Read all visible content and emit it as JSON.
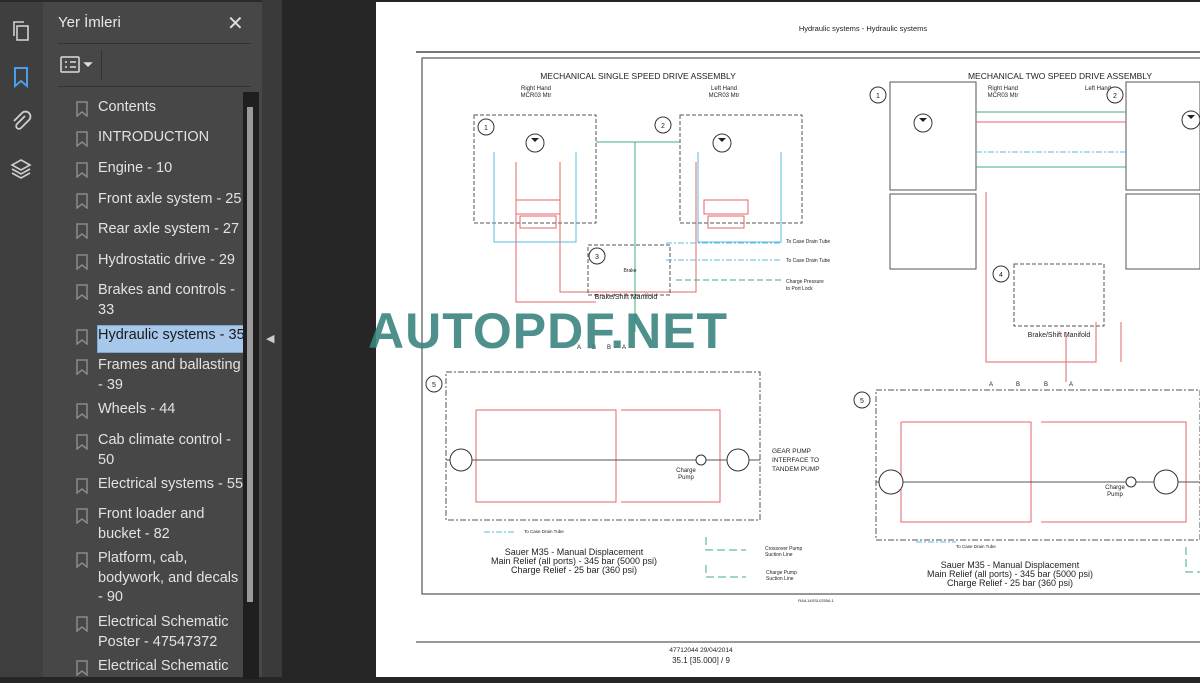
{
  "sidebar": {
    "title": "Yer İmleri",
    "close_icon": "close-icon",
    "options_icon": "list-options-icon",
    "rail_icons": [
      "pages-icon",
      "bookmark-icon",
      "attachment-icon",
      "layers-icon"
    ],
    "accent": "#4a9fe8",
    "items": [
      {
        "label": "Contents"
      },
      {
        "label": "INTRODUCTION"
      },
      {
        "label": "Engine - 10"
      },
      {
        "label": "Front axle system - 25"
      },
      {
        "label": "Rear axle system - 27"
      },
      {
        "label": "Hydrostatic drive - 29"
      },
      {
        "label": "Brakes and controls - 33"
      },
      {
        "label": "Hydraulic systems - 35",
        "selected": true
      },
      {
        "label": "Frames and ballasting - 39"
      },
      {
        "label": "Wheels - 44"
      },
      {
        "label": "Cab climate control - 50"
      },
      {
        "label": "Electrical systems - 55"
      },
      {
        "label": "Front loader and bucket - 82"
      },
      {
        "label": "Platform, cab, bodywork, and decals - 90"
      },
      {
        "label": "Electrical Schematic Poster - 47547372"
      },
      {
        "label": "Electrical Schematic"
      }
    ]
  },
  "document": {
    "header": "Hydraulic systems - Hydraulic systems",
    "watermark": "AUTOPDF.NET",
    "footer_code": "47712044 29/04/2014",
    "footer_page": "35.1 [35.000] / 9",
    "figure_ref": "RAIL14SSL0255A   1",
    "diagram": {
      "left_title": "MECHANICAL SINGLE SPEED DRIVE ASSEMBLY",
      "right_title": "MECHANICAL TWO SPEED DRIVE ASSEMBLY",
      "right_hand": "Right Hand",
      "left_hand": "Left Hand",
      "motor": "MCR03 Mtr",
      "to_case_drain": "To Case Drain Tube",
      "brake_manifold": "Brake/Shift Manifold",
      "charge_pressure": "Charge Pressure",
      "to_port_lock": "to Port Lock",
      "brake": "Brake",
      "shift": "Shift",
      "gear_pump_1": "GEAR PUMP",
      "gear_pump_2": "INTERFACE TO",
      "gear_pump_3": "TANDEM PUMP",
      "charge": "Charge",
      "pump": "Pump",
      "sauer": "Sauer M35 - Manual Displacement",
      "main_relief": "Main Relief (all ports) - 345 bar (5000 psi)",
      "charge_relief": "Charge Relief - 25 bar (360 psi)",
      "crossover_1": "Crossover Pump",
      "crossover_2": "Suction Line",
      "charge_suction_1": "Charge Pump",
      "charge_suction_2": "Suction Line",
      "ports": [
        "A",
        "B",
        "B",
        "A"
      ],
      "callouts": [
        "1",
        "2",
        "3",
        "4",
        "5"
      ]
    }
  }
}
